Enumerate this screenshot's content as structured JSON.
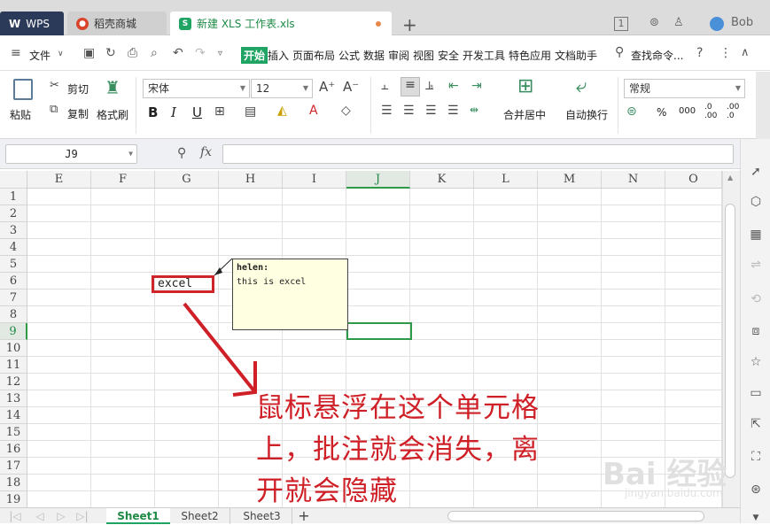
{
  "tabs": {
    "wps": "WPS",
    "store": "稻壳商城",
    "doc": "新建 XLS 工作表.xls",
    "new": "+",
    "badge": "1",
    "user": "Bob"
  },
  "menu": {
    "file": "文件",
    "items": [
      "开始",
      "插入",
      "页面布局",
      "公式",
      "数据",
      "审阅",
      "视图",
      "安全",
      "开发工具",
      "特色应用",
      "文档助手"
    ],
    "search": "查找命令...",
    "help": "?"
  },
  "ribbon": {
    "paste": "粘贴",
    "cut": "剪切",
    "copy": "复制",
    "format_painter": "格式刷",
    "font": "宋体",
    "size": "12",
    "bold": "B",
    "italic": "I",
    "underline": "U",
    "merge": "合并居中",
    "wrap": "自动换行",
    "numfmt": "常规",
    "percent": "%",
    "thousands": "000",
    "inc_dec": ".0 .00",
    "dec_dec": ".00 .0"
  },
  "formula": {
    "namebox": "J9",
    "fx": "fx",
    "value": ""
  },
  "grid": {
    "columns": [
      "E",
      "F",
      "G",
      "H",
      "I",
      "J",
      "K",
      "L",
      "M",
      "N",
      "O"
    ],
    "rows": [
      "1",
      "2",
      "3",
      "4",
      "5",
      "6",
      "7",
      "8",
      "9",
      "10",
      "11",
      "12",
      "13",
      "14",
      "15",
      "16",
      "17",
      "18",
      "19"
    ],
    "active_col": "J",
    "active_row": "9",
    "cell_g6": "excel"
  },
  "comment": {
    "author": "helen:",
    "text": "this is excel"
  },
  "annotation": {
    "line1": "鼠标悬浮在这个单元格",
    "line2": "上，批注就会消失，离",
    "line3": "开就会隐藏"
  },
  "sheets": [
    "Sheet1",
    "Sheet2",
    "Sheet3"
  ],
  "watermark": {
    "logo": "Bai 经验",
    "url": "jingyan.baidu.com"
  },
  "colors": {
    "accent": "#1fa463",
    "annotation": "#cf2027",
    "selection": "#2e9a48"
  }
}
